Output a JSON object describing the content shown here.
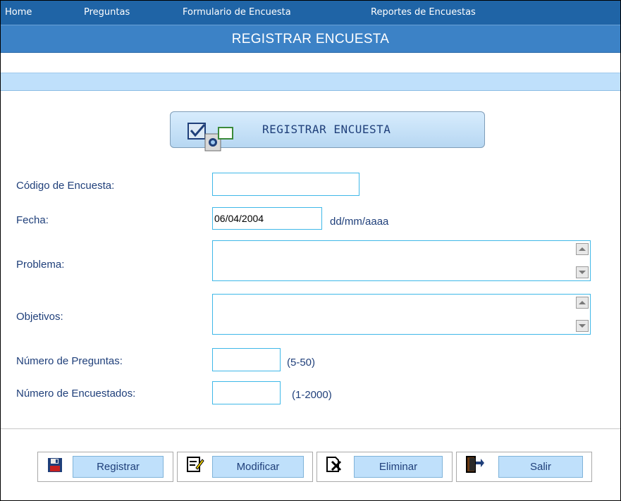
{
  "nav": {
    "items": [
      {
        "label": "Home"
      },
      {
        "label": "Preguntas"
      },
      {
        "label": "Formulario de Encuesta"
      },
      {
        "label": "Reportes de Encuestas"
      }
    ]
  },
  "header": {
    "title": "REGISTRAR ENCUESTA"
  },
  "banner": {
    "label": "REGISTRAR ENCUESTA",
    "icon": "checkbox-survey-icon"
  },
  "form": {
    "codigo": {
      "label": "Código de Encuesta:",
      "value": ""
    },
    "fecha": {
      "label": "Fecha:",
      "value": "06/04/2004",
      "format_hint": "dd/mm/aaaa"
    },
    "problema": {
      "label": "Problema:",
      "value": ""
    },
    "objetivos": {
      "label": "Objetivos:",
      "value": ""
    },
    "num_preguntas": {
      "label": "Número de Preguntas:",
      "value": "",
      "range_hint": "(5-50)"
    },
    "num_encuestados": {
      "label": "Número de Encuestados:",
      "value": "",
      "range_hint": "(1-2000)"
    }
  },
  "actions": {
    "registrar": {
      "label": "Registrar",
      "icon": "floppy-disk-icon"
    },
    "modificar": {
      "label": "Modificar",
      "icon": "edit-document-icon"
    },
    "eliminar": {
      "label": "Eliminar",
      "icon": "delete-document-icon"
    },
    "salir": {
      "label": "Salir",
      "icon": "exit-door-icon"
    }
  },
  "colors": {
    "nav_bg": "#1f64a6",
    "header_bg": "#3c82c6",
    "subbar_bg": "#bfe0fb",
    "label_text": "#1f3f7a",
    "field_border": "#3fb8e8"
  }
}
